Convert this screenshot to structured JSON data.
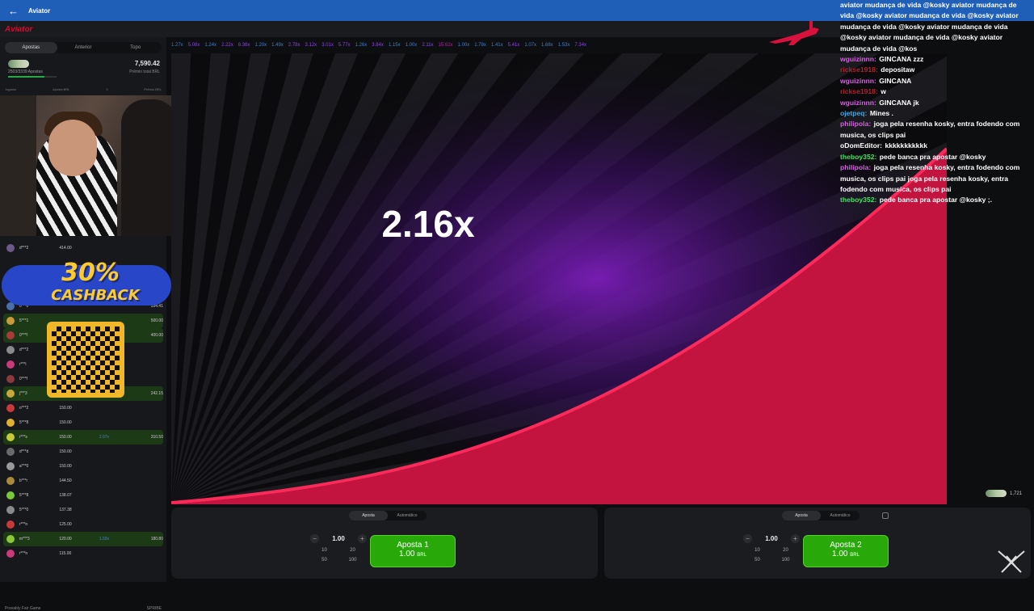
{
  "topbar": {
    "back_icon": "arrow-left-icon",
    "title": "Aviator"
  },
  "logo": "Aviator",
  "sidebar": {
    "tabs": [
      "Apostas",
      "Anterior",
      "Topo"
    ],
    "active_tab": 0,
    "bet_count": "2503/3339 Apostas",
    "progress": 0.75,
    "total": "7,590.42",
    "total_label": "Prêmio total BRL",
    "columns": [
      "Jogador",
      "Aposta BRL",
      "X",
      "Prêmio BRL"
    ],
    "rows": [
      {
        "user": "d***2",
        "amount": "414.00",
        "mult": "",
        "cash": "",
        "win": false,
        "color": "#6b5a8a"
      },
      {
        "user": "0***0",
        "amount": "",
        "mult": "",
        "cash": "534.41",
        "win": false,
        "color": "#4a6fa8"
      },
      {
        "user": "5***1",
        "amount": "",
        "mult": "",
        "cash": "500.00",
        "win": true,
        "color": "#c89a3a"
      },
      {
        "user": "0***f",
        "amount": "",
        "mult": "",
        "cash": "400.00",
        "win": true,
        "color": "#a83a3a"
      },
      {
        "user": "d***2",
        "amount": "",
        "mult": "",
        "cash": "",
        "win": false,
        "color": "#8a8a8a"
      },
      {
        "user": "r***i",
        "amount": "",
        "mult": "",
        "cash": "",
        "win": false,
        "color": "#c83a7a"
      },
      {
        "user": "0***f",
        "amount": "",
        "mult": "",
        "cash": "",
        "win": false,
        "color": "#8a3a3a"
      },
      {
        "user": "j***3",
        "amount": "",
        "mult": "",
        "cash": "242.15",
        "win": true,
        "color": "#c8a83a"
      },
      {
        "user": "o***2",
        "amount": "150.00",
        "mult": "",
        "cash": "",
        "win": false,
        "color": "#c83a3a"
      },
      {
        "user": "5***8",
        "amount": "150.00",
        "mult": "",
        "cash": "",
        "win": false,
        "color": "#e0b030"
      },
      {
        "user": "r***s",
        "amount": "150.00",
        "mult": "2.07x",
        "cash": "310.50",
        "win": true,
        "color": "#c8c83a"
      },
      {
        "user": "d***d",
        "amount": "150.00",
        "mult": "",
        "cash": "",
        "win": false,
        "color": "#6a6a6a"
      },
      {
        "user": "a***0",
        "amount": "150.00",
        "mult": "",
        "cash": "",
        "win": false,
        "color": "#9a9a9a"
      },
      {
        "user": "b***r",
        "amount": "144.50",
        "mult": "",
        "cash": "",
        "win": false,
        "color": "#a88a3a"
      },
      {
        "user": "5***8",
        "amount": "138.07",
        "mult": "",
        "cash": "",
        "win": false,
        "color": "#7ac83a"
      },
      {
        "user": "5***0",
        "amount": "137.38",
        "mult": "",
        "cash": "",
        "win": false,
        "color": "#8a8a8a"
      },
      {
        "user": "r***n",
        "amount": "125.00",
        "mult": "",
        "cash": "",
        "win": false,
        "color": "#c83a3a"
      },
      {
        "user": "m***3",
        "amount": "120.00",
        "mult": "1.59x",
        "cash": "180.80",
        "win": true,
        "color": "#8ac83a"
      },
      {
        "user": "r***n",
        "amount": "115.00",
        "mult": "",
        "cash": "",
        "win": false,
        "color": "#c83a7a"
      }
    ],
    "footer_left": "Provably Fair Game",
    "footer_right": "SPRIBE"
  },
  "promo": {
    "percent": "30%",
    "label": "CASHBACK"
  },
  "history": [
    {
      "v": "1.27x",
      "c": "#3a7fd4"
    },
    {
      "v": "5.08x",
      "c": "#913ef8"
    },
    {
      "v": "1.24x",
      "c": "#3a7fd4"
    },
    {
      "v": "2.22x",
      "c": "#913ef8"
    },
    {
      "v": "6.36x",
      "c": "#913ef8"
    },
    {
      "v": "1.20x",
      "c": "#3a7fd4"
    },
    {
      "v": "1.49x",
      "c": "#3a7fd4"
    },
    {
      "v": "2.78x",
      "c": "#913ef8"
    },
    {
      "v": "3.12x",
      "c": "#913ef8"
    },
    {
      "v": "3.01x",
      "c": "#913ef8"
    },
    {
      "v": "5.77x",
      "c": "#913ef8"
    },
    {
      "v": "1.26x",
      "c": "#3a7fd4"
    },
    {
      "v": "3.84x",
      "c": "#913ef8"
    },
    {
      "v": "1.15x",
      "c": "#3a7fd4"
    },
    {
      "v": "1.00x",
      "c": "#3a7fd4"
    },
    {
      "v": "2.11x",
      "c": "#913ef8"
    },
    {
      "v": "15.62x",
      "c": "#c017b4"
    },
    {
      "v": "1.00x",
      "c": "#3a7fd4"
    },
    {
      "v": "1.78x",
      "c": "#3a7fd4"
    },
    {
      "v": "1.41x",
      "c": "#3a7fd4"
    },
    {
      "v": "5.41x",
      "c": "#913ef8"
    },
    {
      "v": "1.07x",
      "c": "#3a7fd4"
    },
    {
      "v": "1.68x",
      "c": "#3a7fd4"
    },
    {
      "v": "1.53x",
      "c": "#3a7fd4"
    },
    {
      "v": "7.34x",
      "c": "#913ef8"
    }
  ],
  "game": {
    "multiplier": "2.16x",
    "plane_icon": "airplane-icon"
  },
  "online_count": "1,721",
  "bets": [
    {
      "tabs": [
        "Aposta",
        "Automático"
      ],
      "amount": "1.00",
      "quick": [
        "10",
        "20",
        "50",
        "100"
      ],
      "button_line1": "Aposta 1",
      "button_amount": "1.00",
      "currency": "BRL"
    },
    {
      "tabs": [
        "Aposta",
        "Automático"
      ],
      "amount": "1.00",
      "quick": [
        "10",
        "20",
        "50",
        "100"
      ],
      "button_line1": "Aposta 2",
      "button_amount": "1.00",
      "currency": "BRL"
    }
  ],
  "chat": [
    {
      "nick": "",
      "text": "aviator mudança de vida @kosky aviator mudança de vida @kosky aviator mudança de vida @kosky aviator mudança de vida @kosky aviator mudança de vida @kosky aviator mudança de vida @kosky aviator mudança de vida @kos",
      "color": "#ffffff"
    },
    {
      "nick": "wguizinnn",
      "text": "GINCANA zzz",
      "color": "#d45fe0"
    },
    {
      "nick": "rickse1918",
      "text": "depositaw",
      "color": "#b3202a"
    },
    {
      "nick": "wguizinnn",
      "text": "GINCANA",
      "color": "#d45fe0"
    },
    {
      "nick": "rickse1918",
      "text": "w",
      "color": "#b3202a"
    },
    {
      "nick": "wguizinnn",
      "text": "GINCANA jk",
      "color": "#d45fe0"
    },
    {
      "nick": "ojetpeq",
      "text": "Mines .",
      "color": "#3aa8e8"
    },
    {
      "nick": "philipola",
      "text": "joga pela resenha kosky, entra fodendo com musica, os clips pai",
      "color": "#d45fe0"
    },
    {
      "nick": "oDomEditor",
      "text": "kkkkkkkkkkk",
      "color": "#ffffff"
    },
    {
      "nick": "theboy352",
      "text": "pede banca pra apostar @kosky",
      "color": "#3ae85a"
    },
    {
      "nick": "philipola",
      "text": "joga pela resenha kosky, entra fodendo com musica, os clips pai joga pela resenha kosky, entra fodendo com musica, os clips pai",
      "color": "#d45fe0"
    },
    {
      "nick": "theboy352",
      "text": "pede banca pra apostar @kosky ;.",
      "color": "#3ae85a"
    }
  ]
}
